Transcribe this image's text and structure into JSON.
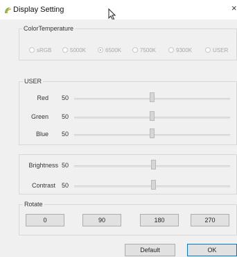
{
  "window": {
    "title": "Display Setting",
    "close_glyph": "×",
    "icon": "app-swirl-icon"
  },
  "color_temperature": {
    "label": "ColorTemperature",
    "options": [
      {
        "label": "sRGB",
        "checked": false
      },
      {
        "label": "5000K",
        "checked": false
      },
      {
        "label": "6500K",
        "checked": true
      },
      {
        "label": "7500K",
        "checked": false
      },
      {
        "label": "9300K",
        "checked": false
      },
      {
        "label": "USER",
        "checked": false
      }
    ]
  },
  "user": {
    "label": "USER",
    "rows": [
      {
        "label": "Red",
        "value": "50",
        "fraction": 0.5
      },
      {
        "label": "Green",
        "value": "50",
        "fraction": 0.5
      },
      {
        "label": "Blue",
        "value": "50",
        "fraction": 0.5
      }
    ]
  },
  "picture": {
    "rows": [
      {
        "label": "Brightness",
        "value": "50",
        "fraction": 0.5
      },
      {
        "label": "Contrast",
        "value": "50",
        "fraction": 0.5
      }
    ]
  },
  "rotate": {
    "label": "Rotate",
    "buttons": [
      "0",
      "90",
      "180",
      "270"
    ]
  },
  "footer": {
    "default_label": "Default",
    "ok_label": "OK"
  }
}
